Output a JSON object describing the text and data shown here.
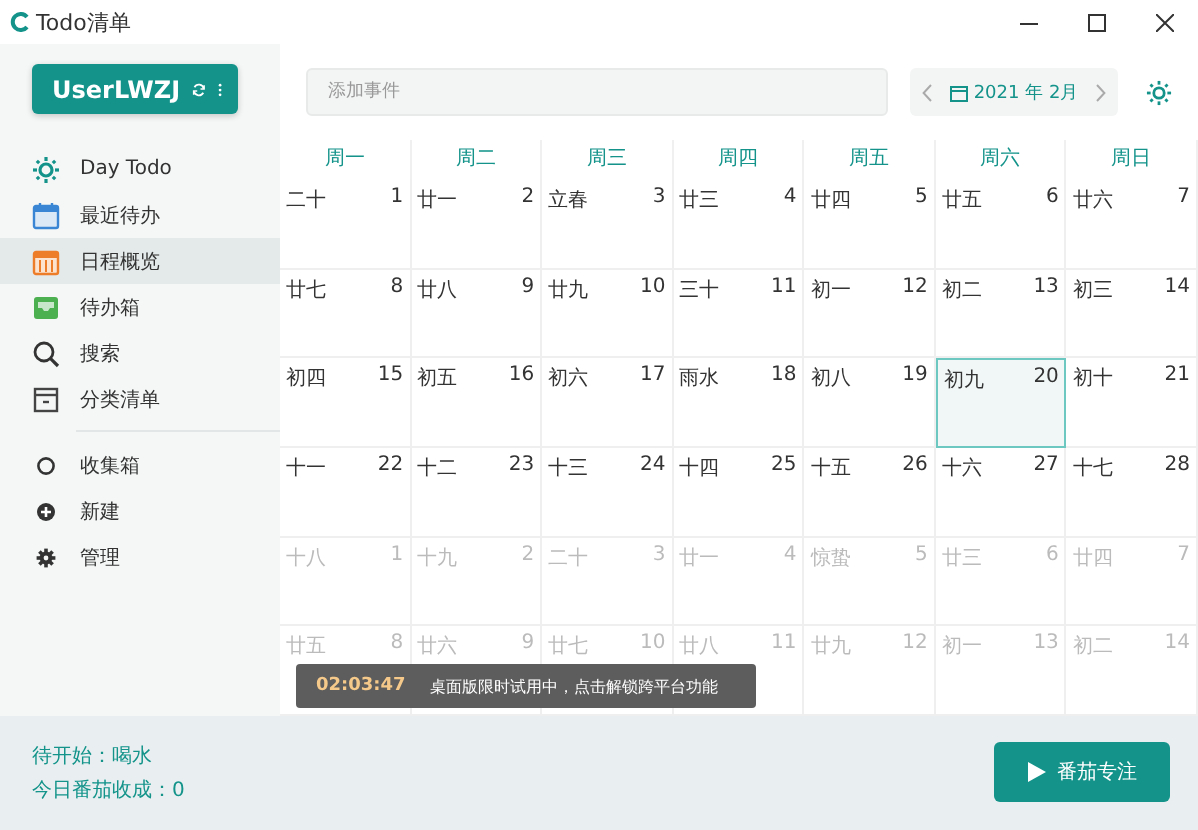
{
  "window": {
    "title": "Todo清单"
  },
  "sidebar": {
    "user": {
      "name": "UserLWZJ"
    },
    "nav": [
      {
        "label": "Day Todo",
        "kind": "sun",
        "selected": false
      },
      {
        "label": "最近待办",
        "kind": "calendar",
        "selected": false
      },
      {
        "label": "日程概览",
        "kind": "schedule",
        "selected": true
      },
      {
        "label": "待办箱",
        "kind": "inbox",
        "selected": false
      },
      {
        "label": "搜索",
        "kind": "search",
        "selected": false
      },
      {
        "label": "分类清单",
        "kind": "list",
        "selected": false
      }
    ],
    "lists": [
      {
        "label": "收集箱",
        "kind": "circle",
        "selected": false
      },
      {
        "label": "新建",
        "kind": "add",
        "selected": false
      },
      {
        "label": "管理",
        "kind": "gear",
        "selected": false
      }
    ]
  },
  "search": {
    "placeholder": "添加事件"
  },
  "month_nav": {
    "label": "2021 年 2月"
  },
  "calendar": {
    "weekdays": [
      "周一",
      "周二",
      "周三",
      "周四",
      "周五",
      "周六",
      "周日"
    ],
    "weeks": [
      [
        {
          "lunar": "二十",
          "day": "1",
          "other_month": false,
          "selected": false
        },
        {
          "lunar": "廿一",
          "day": "2",
          "other_month": false,
          "selected": false
        },
        {
          "lunar": "立春",
          "day": "3",
          "other_month": false,
          "selected": false
        },
        {
          "lunar": "廿三",
          "day": "4",
          "other_month": false,
          "selected": false
        },
        {
          "lunar": "廿四",
          "day": "5",
          "other_month": false,
          "selected": false
        },
        {
          "lunar": "廿五",
          "day": "6",
          "other_month": false,
          "selected": false
        },
        {
          "lunar": "廿六",
          "day": "7",
          "other_month": false,
          "selected": false
        }
      ],
      [
        {
          "lunar": "廿七",
          "day": "8",
          "other_month": false,
          "selected": false
        },
        {
          "lunar": "廿八",
          "day": "9",
          "other_month": false,
          "selected": false
        },
        {
          "lunar": "廿九",
          "day": "10",
          "other_month": false,
          "selected": false
        },
        {
          "lunar": "三十",
          "day": "11",
          "other_month": false,
          "selected": false
        },
        {
          "lunar": "初一",
          "day": "12",
          "other_month": false,
          "selected": false
        },
        {
          "lunar": "初二",
          "day": "13",
          "other_month": false,
          "selected": false
        },
        {
          "lunar": "初三",
          "day": "14",
          "other_month": false,
          "selected": false
        }
      ],
      [
        {
          "lunar": "初四",
          "day": "15",
          "other_month": false,
          "selected": false
        },
        {
          "lunar": "初五",
          "day": "16",
          "other_month": false,
          "selected": false
        },
        {
          "lunar": "初六",
          "day": "17",
          "other_month": false,
          "selected": false
        },
        {
          "lunar": "雨水",
          "day": "18",
          "other_month": false,
          "selected": false
        },
        {
          "lunar": "初八",
          "day": "19",
          "other_month": false,
          "selected": false
        },
        {
          "lunar": "初九",
          "day": "20",
          "other_month": false,
          "selected": true
        },
        {
          "lunar": "初十",
          "day": "21",
          "other_month": false,
          "selected": false
        }
      ],
      [
        {
          "lunar": "十一",
          "day": "22",
          "other_month": false,
          "selected": false
        },
        {
          "lunar": "十二",
          "day": "23",
          "other_month": false,
          "selected": false
        },
        {
          "lunar": "十三",
          "day": "24",
          "other_month": false,
          "selected": false
        },
        {
          "lunar": "十四",
          "day": "25",
          "other_month": false,
          "selected": false
        },
        {
          "lunar": "十五",
          "day": "26",
          "other_month": false,
          "selected": false
        },
        {
          "lunar": "十六",
          "day": "27",
          "other_month": false,
          "selected": false
        },
        {
          "lunar": "十七",
          "day": "28",
          "other_month": false,
          "selected": false
        }
      ],
      [
        {
          "lunar": "十八",
          "day": "1",
          "other_month": true,
          "selected": false
        },
        {
          "lunar": "十九",
          "day": "2",
          "other_month": true,
          "selected": false
        },
        {
          "lunar": "二十",
          "day": "3",
          "other_month": true,
          "selected": false
        },
        {
          "lunar": "廿一",
          "day": "4",
          "other_month": true,
          "selected": false
        },
        {
          "lunar": "惊蛰",
          "day": "5",
          "other_month": true,
          "selected": false
        },
        {
          "lunar": "廿三",
          "day": "6",
          "other_month": true,
          "selected": false
        },
        {
          "lunar": "廿四",
          "day": "7",
          "other_month": true,
          "selected": false
        }
      ],
      [
        {
          "lunar": "廿五",
          "day": "8",
          "other_month": true,
          "selected": false
        },
        {
          "lunar": "廿六",
          "day": "9",
          "other_month": true,
          "selected": false
        },
        {
          "lunar": "廿七",
          "day": "10",
          "other_month": true,
          "selected": false
        },
        {
          "lunar": "廿八",
          "day": "11",
          "other_month": true,
          "selected": false
        },
        {
          "lunar": "廿九",
          "day": "12",
          "other_month": true,
          "selected": false
        },
        {
          "lunar": "初一",
          "day": "13",
          "other_month": true,
          "selected": false
        },
        {
          "lunar": "初二",
          "day": "14",
          "other_month": true,
          "selected": false
        }
      ]
    ]
  },
  "toast": {
    "time": "02:03:47",
    "message": "桌面版限时试用中，点击解锁跨平台功能"
  },
  "footer": {
    "status_lines": [
      "待开始：喝水",
      "今日番茄收成：0"
    ],
    "focus_button": "番茄专注"
  }
}
